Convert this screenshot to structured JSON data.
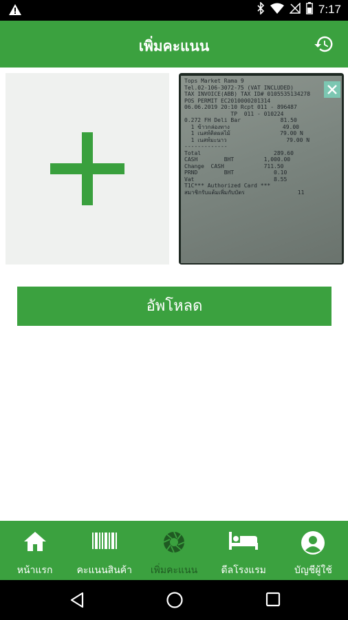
{
  "status_bar": {
    "time": "7:17",
    "icons": [
      "warning-icon",
      "bluetooth-icon",
      "wifi-icon",
      "signal-off-icon",
      "battery-icon"
    ]
  },
  "app_bar": {
    "title": "เพิ่มคะแนน",
    "history_icon": "history-icon"
  },
  "add_photo": {
    "icon": "plus-icon"
  },
  "receipt": {
    "close_icon": "close-icon",
    "lines": [
      "Tops Market Rama 9",
      "Tel.02-106-3072-75 (VAT INCLUDED)",
      "TAX INVOICE(ABB) TAX ID# 0105535134278",
      "POS PERMIT EC2010000201314",
      "06.06.2019 20:10 Rcpt 011 - 896487",
      "              TP  011 - 010224",
      "0.272 FH Deli Bar            81.50",
      "",
      "  1 ข้าวกล่องทาง                49.00",
      "",
      "  1 เนสท์ติดผลไม้               79.00 N",
      "",
      "  1 เนสท์มะนาว                  79.00 N",
      "-------------",
      "Total                      289.60",
      "CASH        BHT         1,000.00",
      "Change  CASH            711.50",
      "PRND        BHT            0.10",
      "Vat                        8.55",
      "",
      "T1C*** Authorized Card ***",
      "สมาชิกรับแต้มเพิ่มกับบัตร                11"
    ]
  },
  "upload_button": {
    "label": "อัพโหลด"
  },
  "bottom_nav": {
    "items": [
      {
        "label": "หน้าแรก",
        "icon": "home-icon",
        "active": false
      },
      {
        "label": "คะแนนสินค้า",
        "icon": "barcode-icon",
        "active": false
      },
      {
        "label": "เพิ่มคะแนน",
        "icon": "camera-aperture-icon",
        "active": true
      },
      {
        "label": "ดีลโรงแรม",
        "icon": "bed-icon",
        "active": false
      },
      {
        "label": "บัญชีผู้ใช้",
        "icon": "account-icon",
        "active": false
      }
    ]
  },
  "colors": {
    "primary": "#3ba13f",
    "active_nav": "#1f5a22",
    "close_button": "#7cc7b2"
  }
}
